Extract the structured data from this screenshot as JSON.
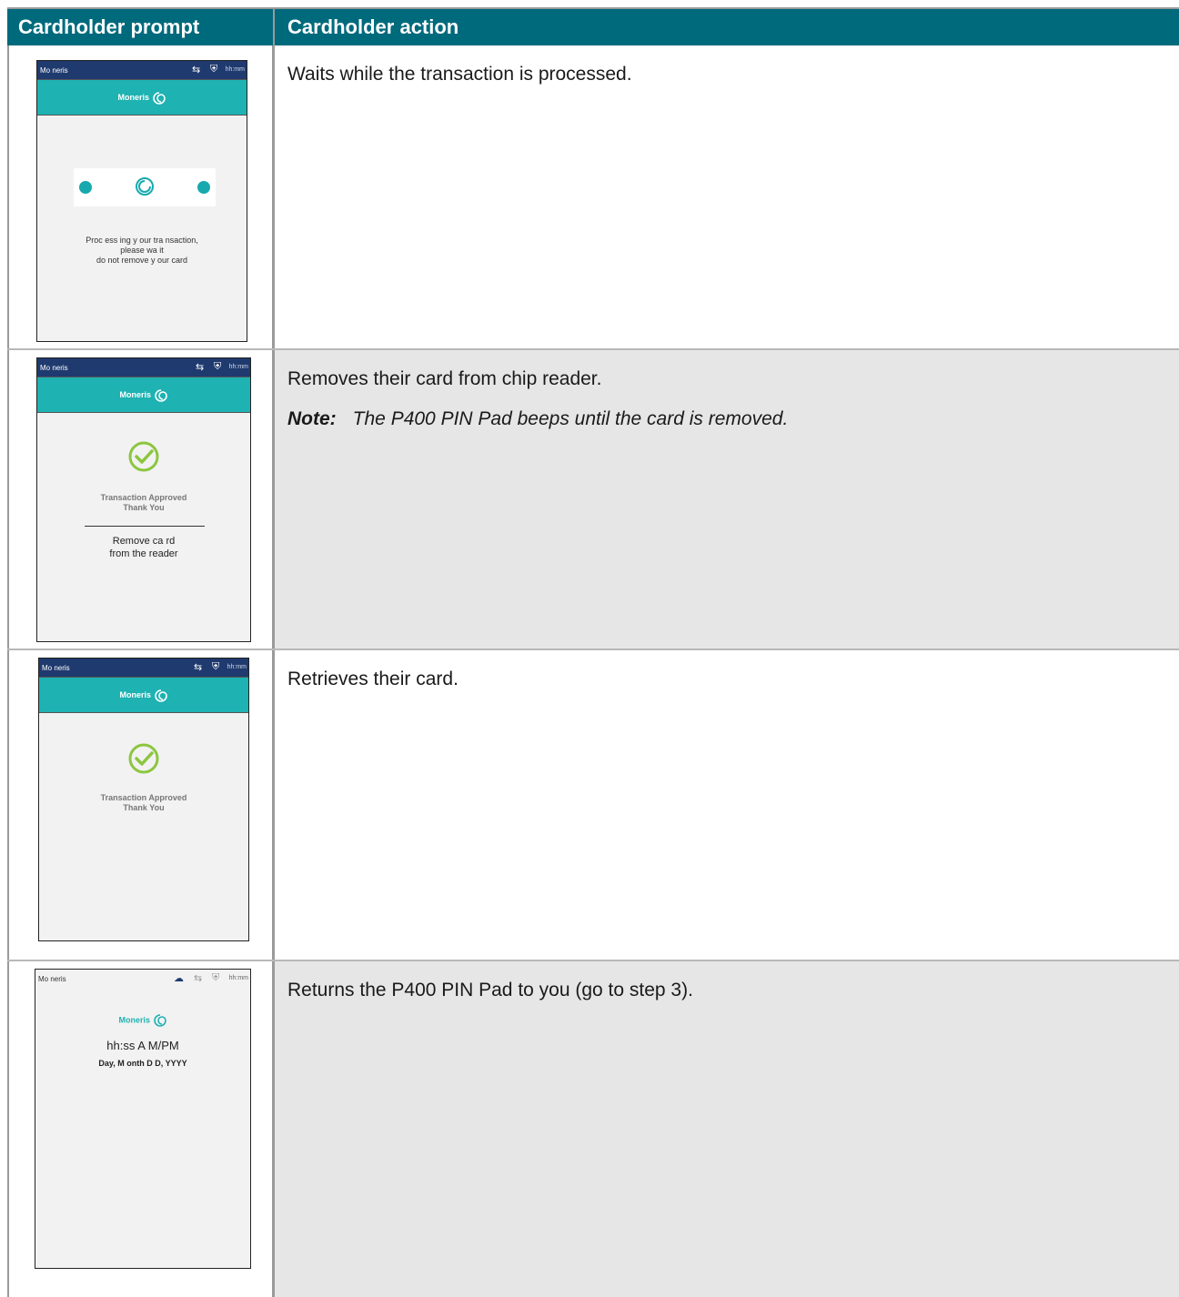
{
  "table": {
    "headers": {
      "prompt": "Cardholder prompt",
      "action": "Cardholder action"
    },
    "rows": [
      {
        "action": "Waits while the transaction is processed.",
        "screen": {
          "brand": "Mo neris",
          "time": "hh:mm",
          "logo_text": "Moneris",
          "message_lines": [
            "Proc ess ing y our tra nsaction,",
            "please wa it",
            "do not remove y our card"
          ]
        }
      },
      {
        "action": "Removes their card from chip reader.",
        "note_label": "Note:",
        "note_text": "The P400 PIN Pad beeps until the card is removed.",
        "screen": {
          "brand": "Mo neris",
          "time": "hh:mm",
          "logo_text": "Moneris",
          "status_lines": [
            "Transaction Approved",
            "Thank You"
          ],
          "instruction_lines": [
            "Remove ca rd",
            "from the reader"
          ]
        }
      },
      {
        "action": "Retrieves their card.",
        "screen": {
          "brand": "Mo neris",
          "time": "hh:mm",
          "logo_text": "Moneris",
          "status_lines": [
            "Transaction Approved",
            "Thank You"
          ]
        }
      },
      {
        "action": "Returns the P400 PIN Pad to you (go to step 3).",
        "screen": {
          "brand": "Mo neris",
          "time": "hh:mm",
          "logo_text": "Moneris",
          "clock": "hh:ss A M/PM",
          "date": "Day, M onth D D, YYYY"
        }
      }
    ]
  },
  "colors": {
    "header_bg": "#006a7d",
    "status_bar": "#1f3a6e",
    "brand_band": "#1eb2b2",
    "check_green": "#8cc63f",
    "dot_teal": "#17a9ad"
  }
}
